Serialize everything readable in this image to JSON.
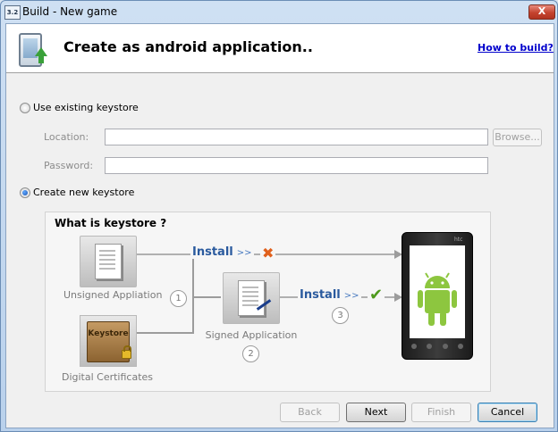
{
  "window": {
    "title": "Build - New game",
    "app_icon_text": "3.2",
    "close_label": "X"
  },
  "header": {
    "title": "Create as android application..",
    "help_link": "How to build?"
  },
  "existing_keystore": {
    "radio_label": "Use existing keystore",
    "selected": false,
    "location_label": "Location:",
    "location_value": "",
    "browse_label": "Browse...",
    "password_label": "Password:",
    "password_value": ""
  },
  "new_keystore": {
    "radio_label": "Create new keystore",
    "selected": true
  },
  "diagram": {
    "title": "What is keystore ?",
    "unsigned_caption": "Unsigned Appliation",
    "certificates_caption": "Digital Certificates",
    "keystore_box_label": "Keystore",
    "signed_caption": "Signed Application",
    "install_label": "Install",
    "install_chevrons": ">>",
    "step1": "1",
    "step2": "2",
    "step3": "3",
    "fail_mark": "✖",
    "success_mark": "✔"
  },
  "footer": {
    "back_label": "Back",
    "next_label": "Next",
    "finish_label": "Finish",
    "cancel_label": "Cancel"
  },
  "colors": {
    "link": "#0000cc",
    "install_text": "#2a5a9e",
    "fail": "#e0601c",
    "success": "#4e9a1c",
    "android_green": "#8dc63f"
  }
}
